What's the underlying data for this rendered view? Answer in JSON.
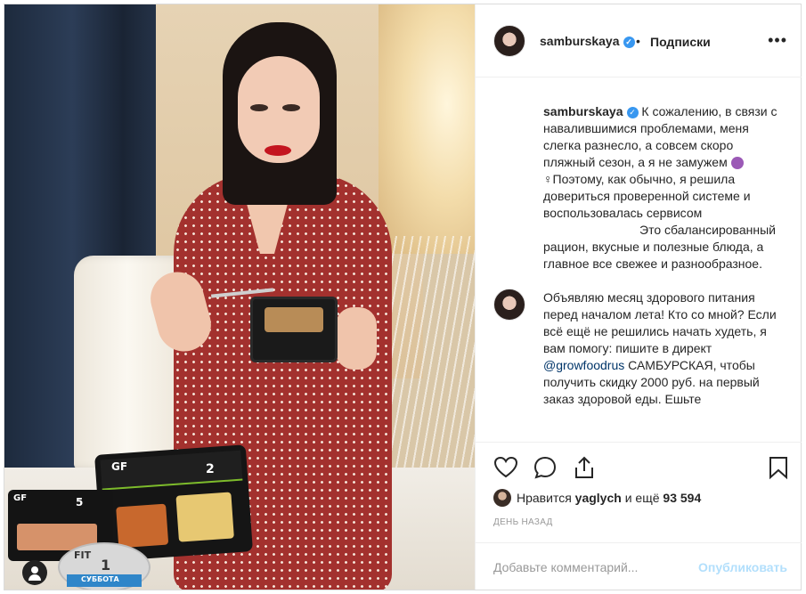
{
  "post": {
    "username": "samburskaya",
    "verified": "✓",
    "separator": "•",
    "follow_label": "Подписки",
    "more_label": "•••"
  },
  "photo": {
    "brand_gf": "GF",
    "box1_number": "2",
    "box2_number": "5",
    "cup_brand": "FIT",
    "cup_number": "1",
    "cup_day": "СУББОТА"
  },
  "caption": {
    "username": "samburskaya",
    "verified": "✓",
    "line1": "К сожалению, в связи с навалившимися проблемами, меня слегка разнесло, а совсем скоро пляжный сезон, а я не замужем",
    "line1b": "♀Поэтому, как обычно, я решила довериться проверенной системе и воспользовалась сервисом",
    "line2": "Это сбалансированный рацион, вкусные и полезные блюда, а главное все свежее и разнообразное.",
    "para2_a": "Объявляю месяц здорового питания перед началом лета! Кто со мной? Если всё ещё не решились начать худеть, я вам помогу: пишите в директ",
    "mention": "@growfoodrus",
    "para2_b": "САМБУРСКАЯ, чтобы получить скидку 2000 руб. на первый заказ здоровой еды. Ешьте"
  },
  "likes": {
    "prefix": "Нравится",
    "user": "yaglych",
    "suffix": "и ещё",
    "count": "93 594"
  },
  "time": "ДЕНЬ НАЗАД",
  "comment": {
    "placeholder": "Добавьте комментарий...",
    "publish_label": "Опубликовать"
  }
}
